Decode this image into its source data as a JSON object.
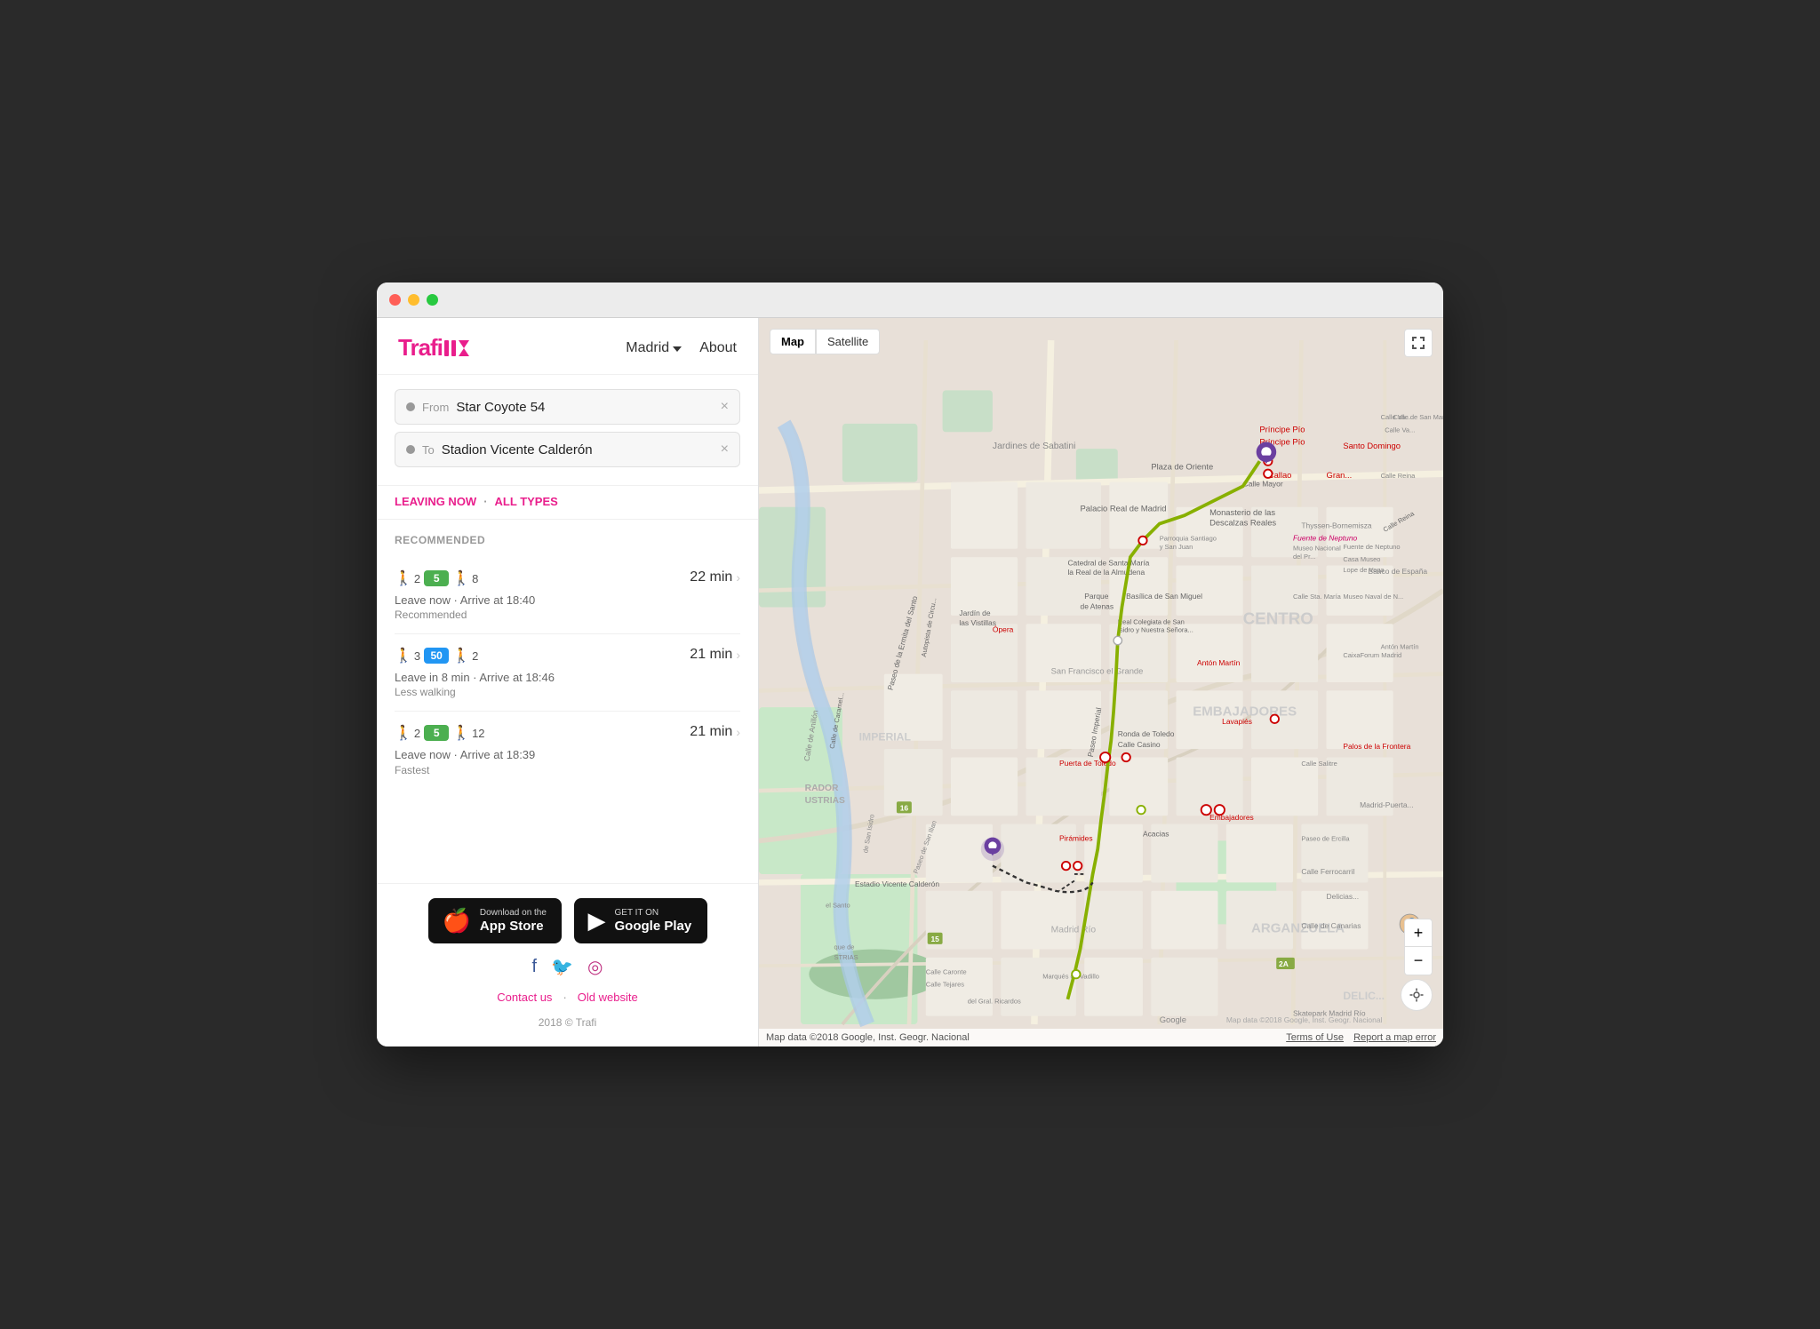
{
  "window": {
    "title": "Trafi"
  },
  "header": {
    "logo": "Trafi",
    "city": "Madrid",
    "about": "About"
  },
  "search": {
    "from_label": "From",
    "from_value": "Star Coyote 54",
    "to_label": "To",
    "to_value": "Stadion Vicente Calderón",
    "clear": "×"
  },
  "filters": {
    "time": "LEAVING NOW",
    "separator": "·",
    "type": "ALL TYPES"
  },
  "routes": {
    "section_label": "RECOMMENDED",
    "items": [
      {
        "walk1": "2",
        "bus": "5",
        "walk2": "8",
        "bus_color": "green",
        "time_info": "Leave now · Arrive at 18:40",
        "tag": "Recommended",
        "duration": "22 min"
      },
      {
        "walk1": "3",
        "bus": "50",
        "walk2": "2",
        "bus_color": "blue",
        "time_info": "Leave in 8 min · Arrive at 18:46",
        "tag": "Less walking",
        "duration": "21 min"
      },
      {
        "walk1": "2",
        "bus": "5",
        "walk2": "12",
        "bus_color": "green",
        "time_info": "Leave now · Arrive at 18:39",
        "tag": "Fastest",
        "duration": "21 min"
      }
    ]
  },
  "footer": {
    "appstore_line1": "Download on the",
    "appstore_line2": "App Store",
    "googleplay_line1": "GET IT ON",
    "googleplay_line2": "Google Play",
    "contact_us": "Contact us",
    "old_website": "Old website",
    "copyright": "2018 © Trafi"
  },
  "map": {
    "view_map": "Map",
    "view_satellite": "Satellite",
    "attribution": "Map data ©2018 Google, Inst. Geogr. Nacional",
    "terms": "Terms of Use",
    "report": "Report a map error"
  }
}
